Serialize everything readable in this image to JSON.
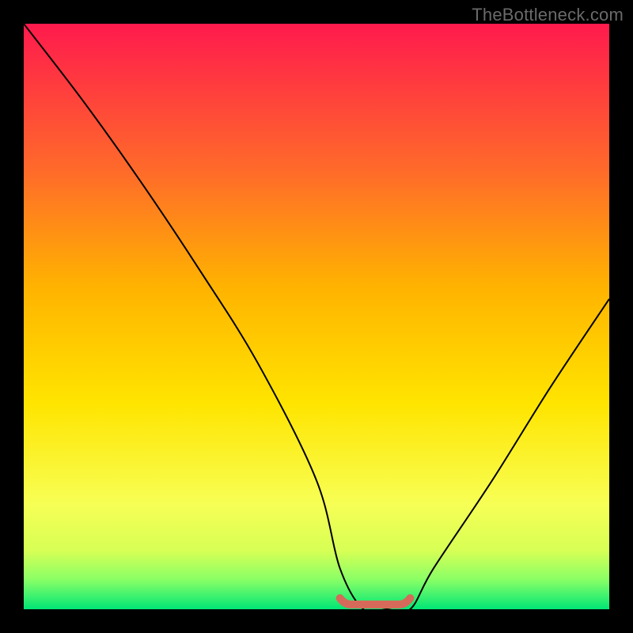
{
  "watermark": "TheBottleneck.com",
  "chart_data": {
    "type": "line",
    "title": "",
    "xlabel": "",
    "ylabel": "",
    "xlim": [
      0,
      100
    ],
    "ylim": [
      0,
      100
    ],
    "x": [
      0,
      10,
      20,
      30,
      40,
      50,
      54,
      58,
      62,
      66,
      70,
      80,
      90,
      100
    ],
    "values": [
      100,
      87,
      73,
      58,
      42,
      22,
      7,
      0,
      0,
      0,
      7,
      22,
      38,
      53
    ],
    "optimal_region": {
      "x_start": 54,
      "x_end": 66,
      "y": 0
    },
    "background_gradient": {
      "type": "vertical",
      "stops": [
        {
          "pos": 0.0,
          "color": "#ff1a4d"
        },
        {
          "pos": 0.25,
          "color": "#ff6a2a"
        },
        {
          "pos": 0.45,
          "color": "#ffb300"
        },
        {
          "pos": 0.65,
          "color": "#ffe500"
        },
        {
          "pos": 0.82,
          "color": "#f7ff55"
        },
        {
          "pos": 0.9,
          "color": "#d7ff55"
        },
        {
          "pos": 0.95,
          "color": "#88ff66"
        },
        {
          "pos": 1.0,
          "color": "#00e676"
        }
      ]
    },
    "curve_color": "#000000",
    "optimal_color": "#d66a5a"
  }
}
